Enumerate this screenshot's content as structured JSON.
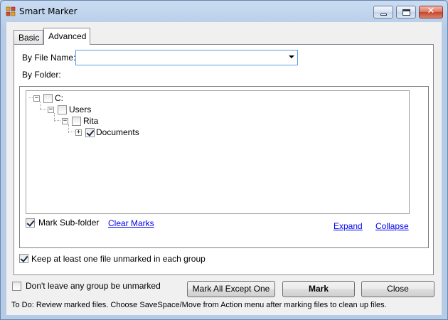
{
  "window": {
    "title": "Smart Marker",
    "icon": "smart-marker-app-icon",
    "controls": [
      "minimize",
      "maximize",
      "close"
    ]
  },
  "tabs": [
    {
      "label": "Basic",
      "selected": false
    },
    {
      "label": "Advanced",
      "selected": true
    }
  ],
  "advanced": {
    "by_file_name_label": "By File Name:",
    "by_file_name_value": "",
    "by_folder_label": "By Folder:",
    "tree": {
      "c": {
        "label": "C:",
        "checked": false,
        "expanded": true
      },
      "users": {
        "label": "Users",
        "checked": false,
        "expanded": true
      },
      "rita": {
        "label": "Rita",
        "checked": false,
        "expanded": true
      },
      "documents": {
        "label": "Documents",
        "checked": true,
        "expanded": false
      }
    },
    "mark_subfolder_label": "Mark Sub-folder",
    "mark_subfolder_checked": true,
    "clear_marks_label": "Clear Marks",
    "expand_label": "Expand",
    "collapse_label": "Collapse",
    "keep_one_unmarked_label": "Keep at least one file unmarked in each group",
    "keep_one_unmarked_checked": true
  },
  "dont_leave_label": "Don't leave any group be unmarked",
  "dont_leave_checked": false,
  "buttons": {
    "mark_all_except_one": "Mark All Except One",
    "mark": "Mark",
    "close": "Close"
  },
  "status": "To Do: Review marked files. Choose SaveSpace/Move from Action menu after marking files to clean up files."
}
